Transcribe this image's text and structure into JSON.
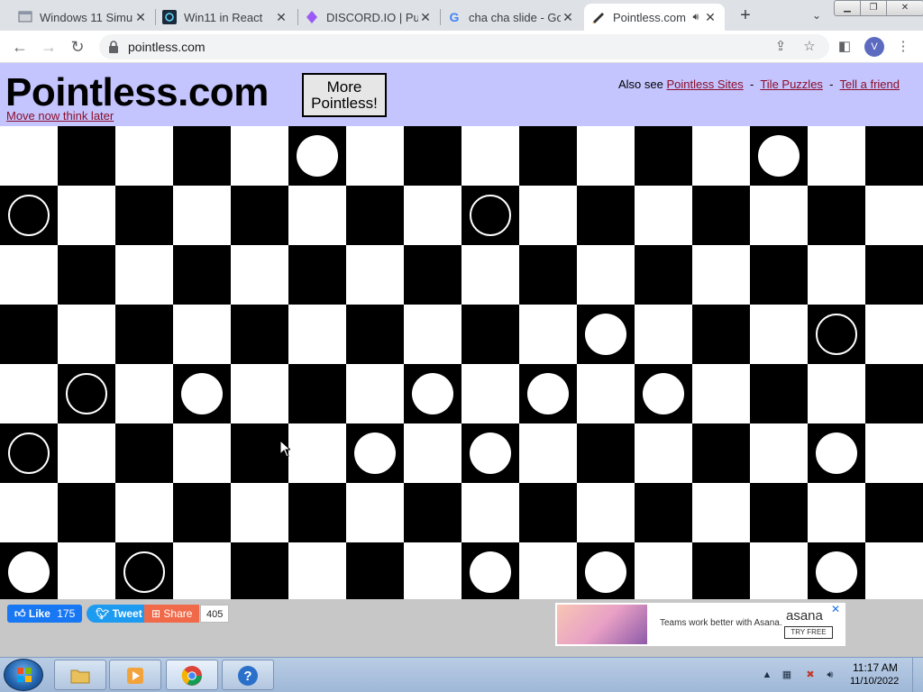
{
  "browser": {
    "tabs": [
      {
        "title": "Windows 11 Simu",
        "icon": "page-icon"
      },
      {
        "title": "Win11 in React",
        "icon": "react-icon"
      },
      {
        "title": "DISCORD.IO | Pub",
        "icon": "discord-icon"
      },
      {
        "title": "cha cha slide - Go",
        "icon": "google-icon"
      },
      {
        "title": "Pointless.com",
        "icon": "pencil-icon",
        "active": true
      }
    ],
    "url": "pointless.com",
    "profile_initial": "V"
  },
  "page": {
    "logo": "Pointless.com",
    "tagline": "Move now think later",
    "more_button": "More Pointless!",
    "also_see": {
      "prefix": "Also see",
      "links": [
        "Pointless Sites",
        "Tile Puzzles",
        "Tell a friend"
      ],
      "separator": "-"
    },
    "board": {
      "cols": 16,
      "rows": 8,
      "pieces": [
        {
          "col": 5,
          "row": 0,
          "color": "white"
        },
        {
          "col": 13,
          "row": 0,
          "color": "white"
        },
        {
          "col": 0,
          "row": 1,
          "color": "black"
        },
        {
          "col": 8,
          "row": 1,
          "color": "black"
        },
        {
          "col": 10,
          "row": 3,
          "color": "white"
        },
        {
          "col": 14,
          "row": 3,
          "color": "black"
        },
        {
          "col": 1,
          "row": 4,
          "color": "black"
        },
        {
          "col": 3,
          "row": 4,
          "color": "white"
        },
        {
          "col": 7,
          "row": 4,
          "color": "white"
        },
        {
          "col": 9,
          "row": 4,
          "color": "white"
        },
        {
          "col": 11,
          "row": 4,
          "color": "white"
        },
        {
          "col": 0,
          "row": 5,
          "color": "black"
        },
        {
          "col": 6,
          "row": 5,
          "color": "white"
        },
        {
          "col": 8,
          "row": 5,
          "color": "white"
        },
        {
          "col": 14,
          "row": 5,
          "color": "white"
        },
        {
          "col": 0,
          "row": 7,
          "color": "white"
        },
        {
          "col": 2,
          "row": 7,
          "color": "black"
        },
        {
          "col": 8,
          "row": 7,
          "color": "white"
        },
        {
          "col": 10,
          "row": 7,
          "color": "white"
        },
        {
          "col": 14,
          "row": 7,
          "color": "white"
        }
      ]
    },
    "social": {
      "like": "Like",
      "like_count": "175",
      "tweet": "Tweet",
      "share": "Share",
      "share_count": "405"
    },
    "ad": {
      "text": "Teams work better with Asana.",
      "brand": "asana",
      "cta": "TRY FREE"
    }
  },
  "taskbar": {
    "time": "11:17 AM",
    "date": "11/10/2022"
  }
}
